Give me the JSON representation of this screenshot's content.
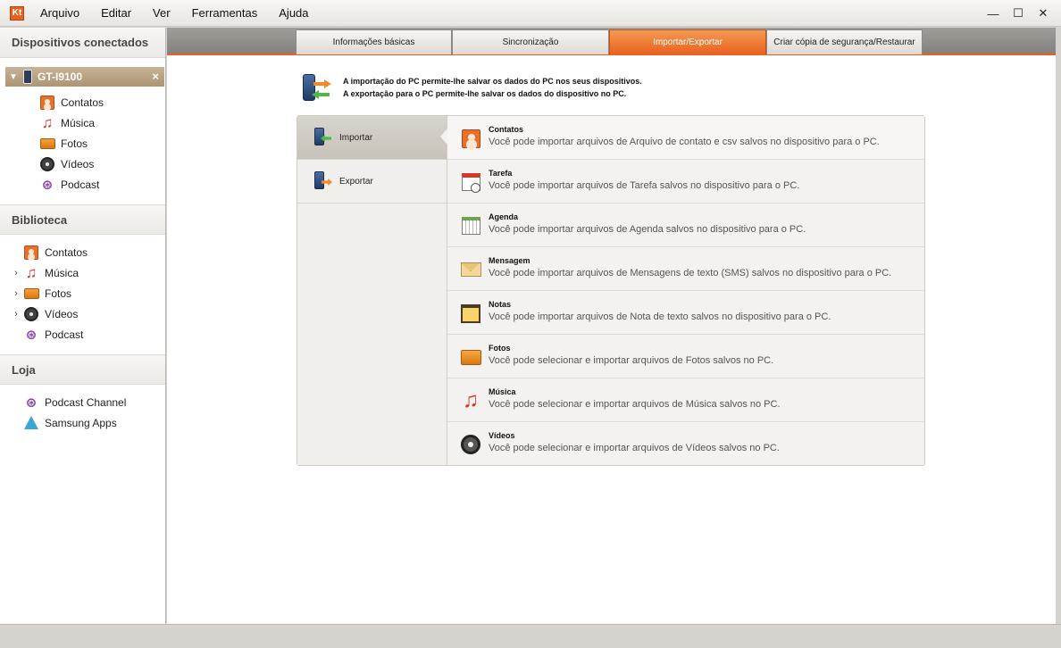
{
  "app": {
    "logo_text": "Kt",
    "accent": "#e8611f"
  },
  "menu": [
    "Arquivo",
    "Editar",
    "Ver",
    "Ferramentas",
    "Ajuda"
  ],
  "window_controls": {
    "minimize": "—",
    "maximize": "☐",
    "close": "✕"
  },
  "sidebar": {
    "connected_title": "Dispositivos conectados",
    "device": {
      "name": "GT-I9100",
      "close": "×"
    },
    "device_items": [
      {
        "label": "Contatos",
        "icon": "contacts-icon"
      },
      {
        "label": "Música",
        "icon": "music-icon"
      },
      {
        "label": "Fotos",
        "icon": "photos-icon"
      },
      {
        "label": "Vídeos",
        "icon": "videos-icon"
      },
      {
        "label": "Podcast",
        "icon": "podcast-icon"
      }
    ],
    "library_title": "Biblioteca",
    "library_items": [
      {
        "label": "Contatos",
        "icon": "contacts-icon"
      },
      {
        "label": "Música",
        "icon": "music-icon"
      },
      {
        "label": "Fotos",
        "icon": "photos-icon"
      },
      {
        "label": "Vídeos",
        "icon": "videos-icon"
      },
      {
        "label": "Podcast",
        "icon": "podcast-icon"
      }
    ],
    "store_title": "Loja",
    "store_items": [
      {
        "label": "Podcast Channel",
        "icon": "podcast-icon"
      },
      {
        "label": "Samsung Apps",
        "icon": "samsung-apps-icon"
      }
    ]
  },
  "tabs": [
    {
      "label": "Informações básicas"
    },
    {
      "label": "Sincronização"
    },
    {
      "label": "Importar/Exportar"
    },
    {
      "label": "Criar cópia de segurança/Restaurar"
    }
  ],
  "intro": {
    "line1": "A importação do PC permite-lhe salvar os dados do PC nos seus dispositivos.",
    "line2": "A exportação para o PC permite-lhe salvar os dados do dispositivo no PC."
  },
  "modes": [
    {
      "label": "Importar"
    },
    {
      "label": "Exportar"
    }
  ],
  "import_items": [
    {
      "title": "Contatos",
      "desc": "Você pode importar arquivos de Arquivo de contato e csv salvos no dispositivo para o PC.",
      "icon": "contacts-icon"
    },
    {
      "title": "Tarefa",
      "desc": "Você pode importar arquivos de Tarefa salvos no dispositivo para o PC.",
      "icon": "task-icon"
    },
    {
      "title": "Agenda",
      "desc": "Você pode importar arquivos de Agenda salvos no dispositivo para o PC.",
      "icon": "calendar-icon"
    },
    {
      "title": "Mensagem",
      "desc": "Você pode importar arquivos de Mensagens de texto (SMS) salvos no dispositivo para o PC.",
      "icon": "message-icon"
    },
    {
      "title": "Notas",
      "desc": "Você pode importar arquivos de Nota de texto salvos no dispositivo para o PC.",
      "icon": "notes-icon"
    },
    {
      "title": "Fotos",
      "desc": "Você pode selecionar e importar arquivos de Fotos salvos no PC.",
      "icon": "photos-icon"
    },
    {
      "title": "Música",
      "desc": "Você pode selecionar e importar arquivos de Música salvos no PC.",
      "icon": "music-icon"
    },
    {
      "title": "Vídeos",
      "desc": "Você pode selecionar e importar arquivos de Vídeos salvos no PC.",
      "icon": "videos-icon"
    }
  ]
}
